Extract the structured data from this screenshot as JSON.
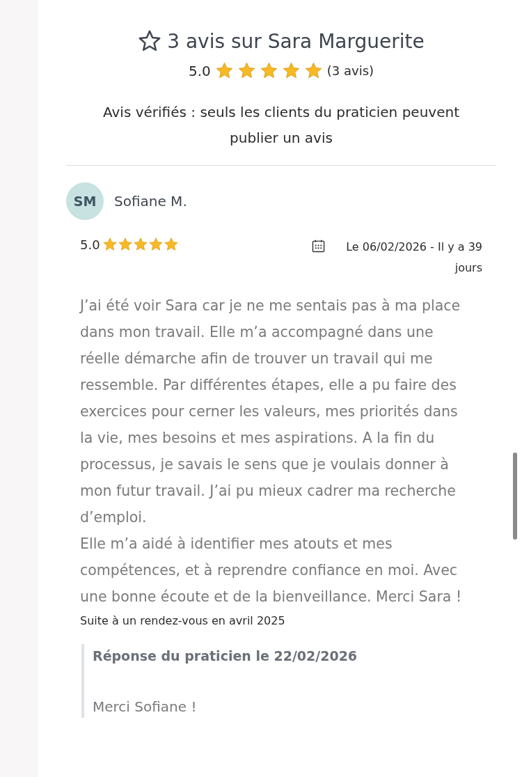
{
  "header": {
    "title": "3 avis sur Sara Marguerite",
    "score": "5.0",
    "stars": 5,
    "count": "(3 avis)",
    "notice": "Avis vérifiés : seuls les clients du praticien peuvent publier un avis"
  },
  "reviews": [
    {
      "initials": "SM",
      "author": "Sofiane M.",
      "score": "5.0",
      "stars": 5,
      "date": "Le 06/02/2026 - Il y a 39 jours",
      "paragraphs": [
        "J’ai été voir Sara car je ne me sentais pas à ma place dans mon travail. Elle m’a accompagné dans une réelle démarche afin de trouver un travail qui me ressemble. Par différentes étapes, elle a pu faire des exercices pour cerner les valeurs, mes priorités dans la vie, mes besoins et mes aspirations. A la fin du processus, je savais le sens que je voulais donner à mon futur travail. J’ai pu mieux cadrer ma recherche d’emploi.",
        "Elle m’a aidé à identifier mes atouts et mes compétences, et à reprendre confiance en moi. Avec une bonne écoute et de la bienveillance. Merci Sara !"
      ],
      "context": "Suite à un rendez-vous en avril 2025",
      "reply": {
        "heading": "Réponse du praticien le 22/02/2026",
        "text": "Merci Sofiane !"
      }
    }
  ]
}
